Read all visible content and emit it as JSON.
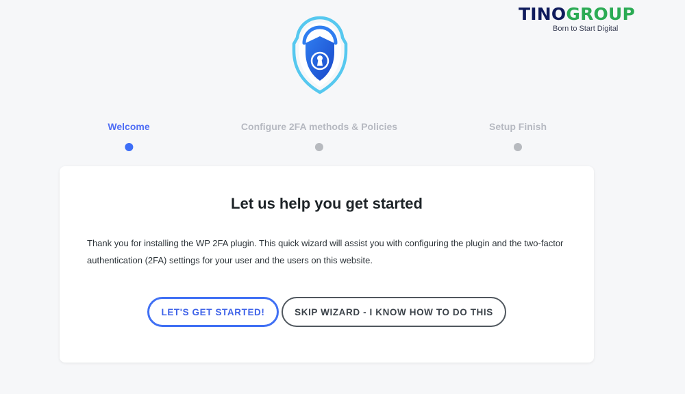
{
  "branding": {
    "name_part1": "TINO",
    "name_part2": "GROUP",
    "tagline": "Born to Start Digital",
    "colors": {
      "primary": "#0f1b5c",
      "accent": "#2bab54"
    }
  },
  "hero_icon": "shield-lock-icon",
  "steps": [
    {
      "label": "Welcome",
      "active": true
    },
    {
      "label": "Configure 2FA methods & Policies",
      "active": false
    },
    {
      "label": "Setup Finish",
      "active": false
    }
  ],
  "card": {
    "title": "Let us help you get started",
    "description": "Thank you for installing the WP 2FA plugin. This quick wizard will assist you with configuring the plugin and the two-factor authentication (2FA) settings for your user and the users on this website.",
    "primary_button": "LET'S GET STARTED!",
    "secondary_button": "SKIP WIZARD - I KNOW HOW TO DO THIS"
  },
  "colors": {
    "accent": "#3d6ef7",
    "inactive": "#b7babf",
    "background": "#f6f7f9"
  }
}
